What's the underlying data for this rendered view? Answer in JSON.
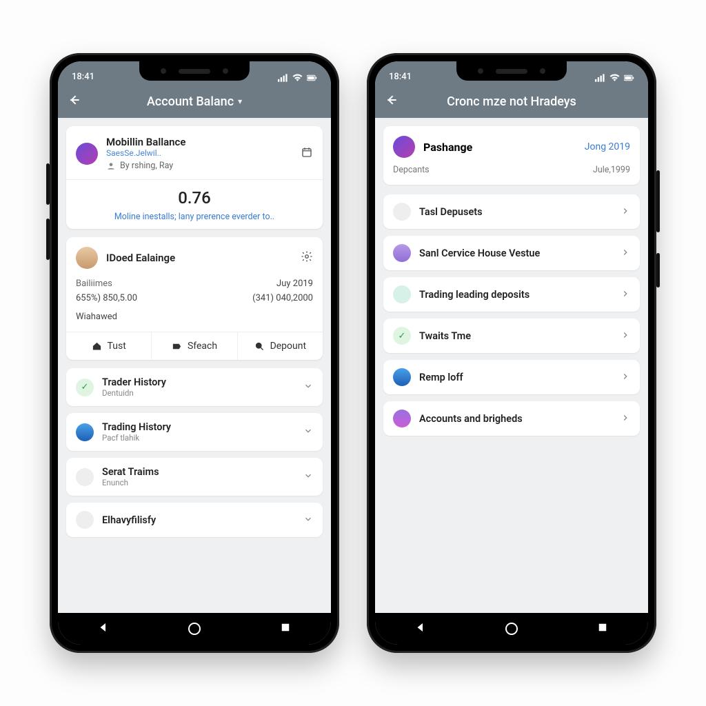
{
  "status_time": "18:41",
  "left": {
    "title": "Account Balanc",
    "card1": {
      "title": "Mobillin Ballance",
      "subtitle": "SaesSe.Jelwil..",
      "byline": "By rshing, Ray",
      "value": "0.76",
      "link": "Moline inestalls; lany prerence everder to.."
    },
    "card2": {
      "title": "IDoed Ealainge",
      "left_label": "Bailiimes",
      "left_val": "655%) 850,5.00",
      "right_label": "Juy 2019",
      "right_val": "(341) 040,2000",
      "status": "Wiahawed",
      "actions": [
        "Tust",
        "Sfeach",
        "Depount"
      ]
    },
    "list": [
      {
        "title": "Trader History",
        "sub": "Dentuidn",
        "circle": "c-green",
        "glyph": "✓",
        "chev": "down"
      },
      {
        "title": "Trading History",
        "sub": "Pacf tlahik",
        "circle": "c-blue",
        "glyph": "",
        "chev": "down"
      },
      {
        "title": "Serat Traims",
        "sub": "Enunch",
        "circle": "c-grey",
        "glyph": "",
        "chev": "down"
      },
      {
        "title": "Elhavyfilisfy",
        "sub": "",
        "circle": "c-grey",
        "glyph": "",
        "chev": "down"
      }
    ]
  },
  "right": {
    "title": "Cronc mze not Hradeys",
    "header": {
      "name": "Pashange",
      "link": "Jong 2019",
      "meta_l": "Depcants",
      "meta_r": "Jule,1999"
    },
    "list": [
      {
        "title": "Tasl Depusets",
        "circle": "c-grey"
      },
      {
        "title": "Sanl Cervice House Vestue",
        "circle": "c-lav"
      },
      {
        "title": "Trading leading deposits",
        "circle": "c-teal"
      },
      {
        "title": "Twaits Tme",
        "circle": "c-green",
        "glyph": "✓"
      },
      {
        "title": "Remp loff",
        "circle": "c-blue"
      },
      {
        "title": "Accounts and brigheds",
        "circle": "c-purple"
      }
    ]
  }
}
